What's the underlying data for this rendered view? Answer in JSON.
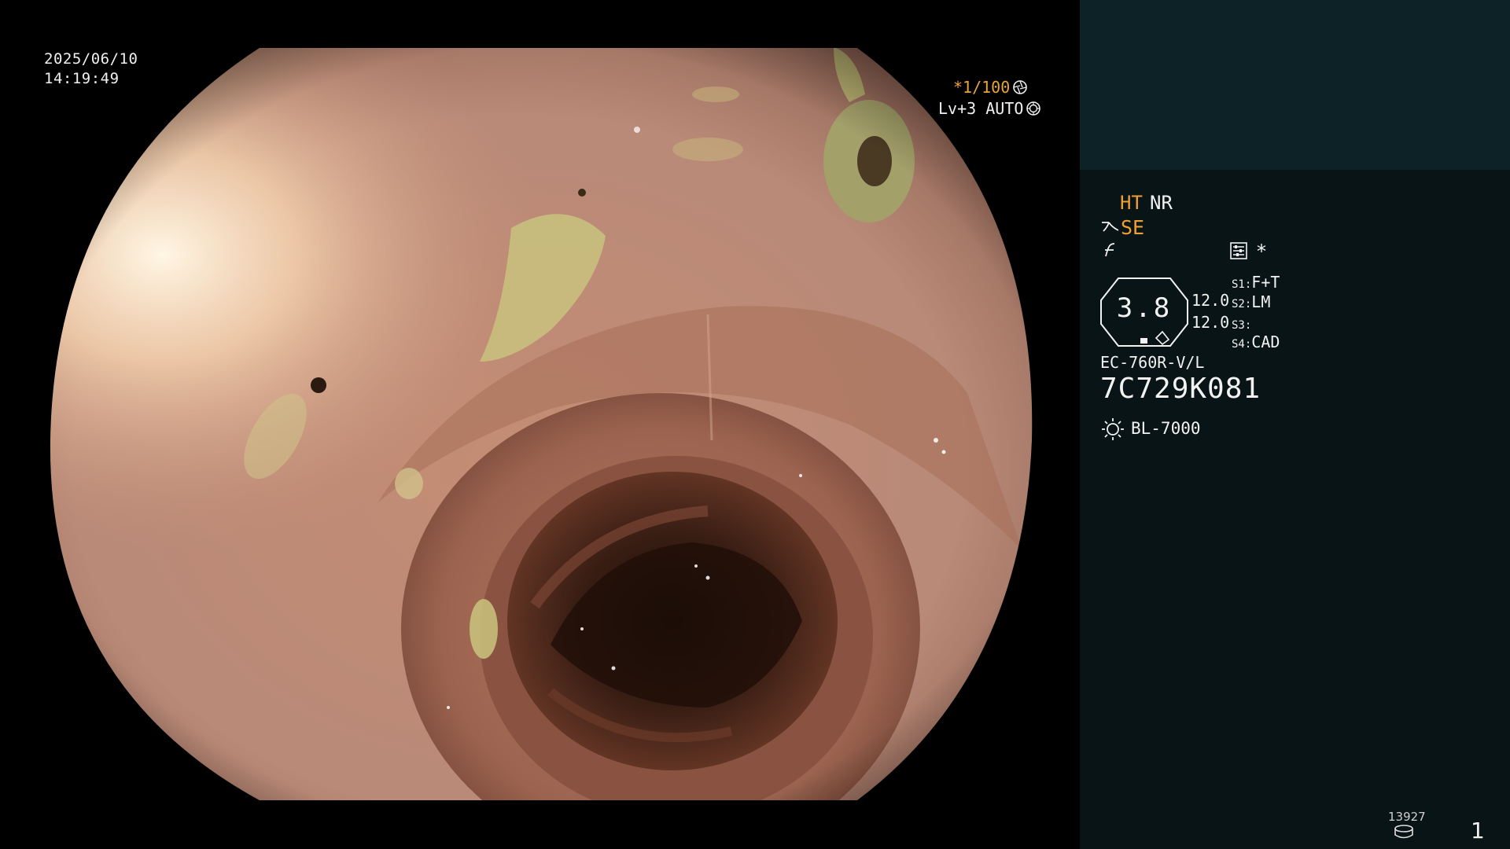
{
  "video": {
    "date": "2025/06/10",
    "time": "14:19:49",
    "shutter": "*1/100",
    "level": "Lv+3 AUTO",
    "shutter_icon": "aperture-icon",
    "level_icon": "iris-icon"
  },
  "panel": {
    "ht_label": "HT",
    "nr_label": "NR",
    "se_label": "SE",
    "se_icon": "structure-enhance-icon",
    "freeze_icon": "freeze-icon",
    "menu_icon": "settings-list-icon",
    "asterisk": "*",
    "zoom_value": "3.8",
    "value_1": "12.0",
    "value_2": "12.0",
    "slots": [
      {
        "key": "S1:",
        "value": "F+T"
      },
      {
        "key": "S2:",
        "value": "LM"
      },
      {
        "key": "S3:",
        "value": ""
      },
      {
        "key": "S4:",
        "value": "CAD"
      }
    ],
    "scope_model": "EC-760R-V/L",
    "scope_serial": "7C729K081",
    "light_source": "BL-7000",
    "light_icon": "light-source-icon",
    "image_count": "13927",
    "storage_icon": "storage-disk-icon",
    "page_number": "1"
  },
  "colors": {
    "accent_orange": "#f0a030",
    "panel_top": "#0c2226",
    "panel_bottom": "#091416"
  }
}
